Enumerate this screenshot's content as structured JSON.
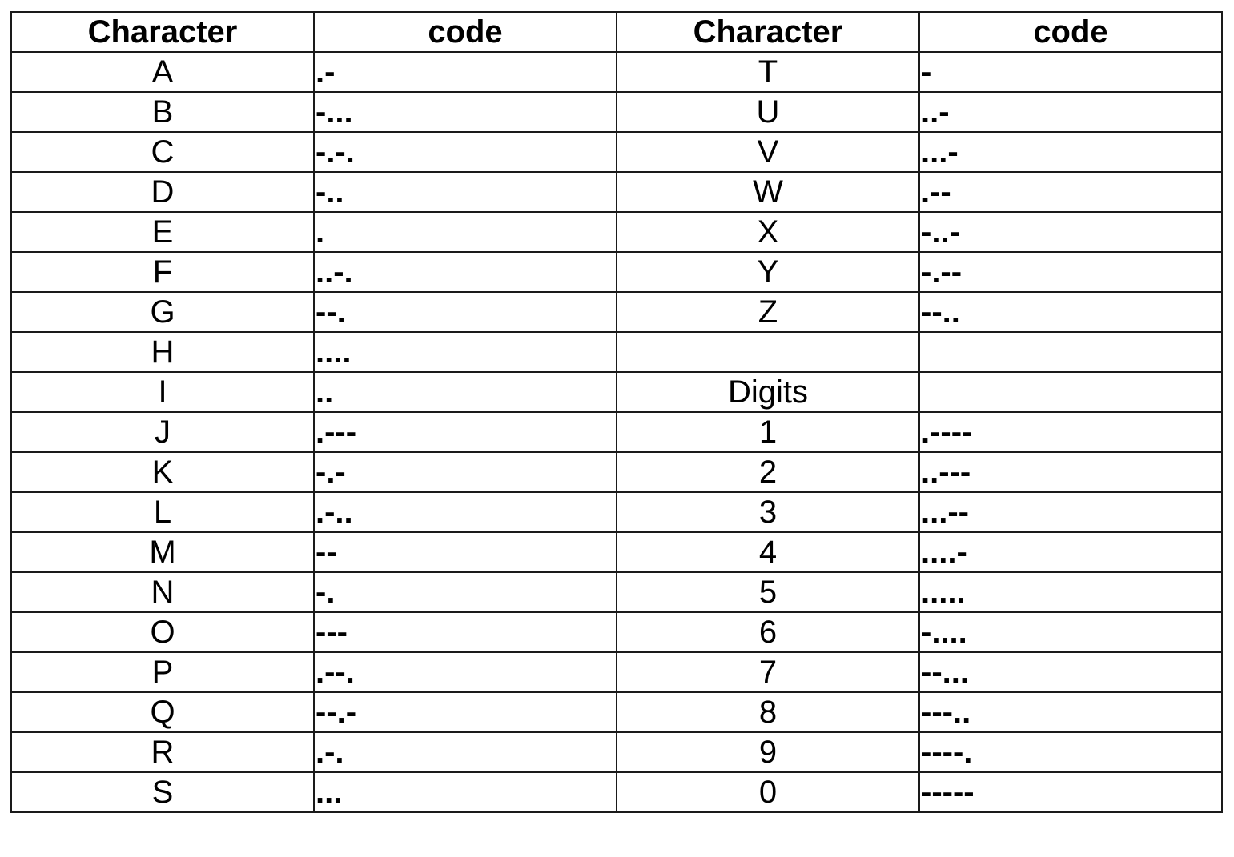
{
  "table": {
    "headers": [
      "Character",
      "code",
      "Character",
      "code"
    ],
    "rows": [
      {
        "char_left": "A",
        "code_left": ".-",
        "char_right": "T",
        "code_right": "-"
      },
      {
        "char_left": "B",
        "code_left": "-...",
        "char_right": "U",
        "code_right": "..-"
      },
      {
        "char_left": "C",
        "code_left": "-.-.",
        "char_right": "V",
        "code_right": "...-"
      },
      {
        "char_left": "D",
        "code_left": "-..",
        "char_right": "W",
        "code_right": ".--"
      },
      {
        "char_left": "E",
        "code_left": ".",
        "char_right": "X",
        "code_right": "-..-"
      },
      {
        "char_left": "F",
        "code_left": "..-.",
        "char_right": "Y",
        "code_right": "-.--"
      },
      {
        "char_left": "G",
        "code_left": "--.",
        "char_right": "Z",
        "code_right": "--.."
      },
      {
        "char_left": "H",
        "code_left": "....",
        "char_right": "",
        "code_right": ""
      },
      {
        "char_left": "I",
        "code_left": "..",
        "char_right": "Digits",
        "code_right": ""
      },
      {
        "char_left": "J",
        "code_left": ".---",
        "char_right": "1",
        "code_right": ".----"
      },
      {
        "char_left": "K",
        "code_left": "-.-",
        "char_right": "2",
        "code_right": "..---"
      },
      {
        "char_left": "L",
        "code_left": ".-..",
        "char_right": "3",
        "code_right": "...--"
      },
      {
        "char_left": "M",
        "code_left": "--",
        "char_right": "4",
        "code_right": "....-"
      },
      {
        "char_left": "N",
        "code_left": "-.",
        "char_right": "5",
        "code_right": "....."
      },
      {
        "char_left": "O",
        "code_left": "---",
        "char_right": "6",
        "code_right": "-...."
      },
      {
        "char_left": "P",
        "code_left": ".--.",
        "char_right": "7",
        "code_right": "--..."
      },
      {
        "char_left": "Q",
        "code_left": "--.-",
        "char_right": "8",
        "code_right": "---.."
      },
      {
        "char_left": "R",
        "code_left": ".-.",
        "char_right": "9",
        "code_right": "----."
      },
      {
        "char_left": "S",
        "code_left": "...",
        "char_right": "0",
        "code_right": "-----"
      }
    ]
  }
}
